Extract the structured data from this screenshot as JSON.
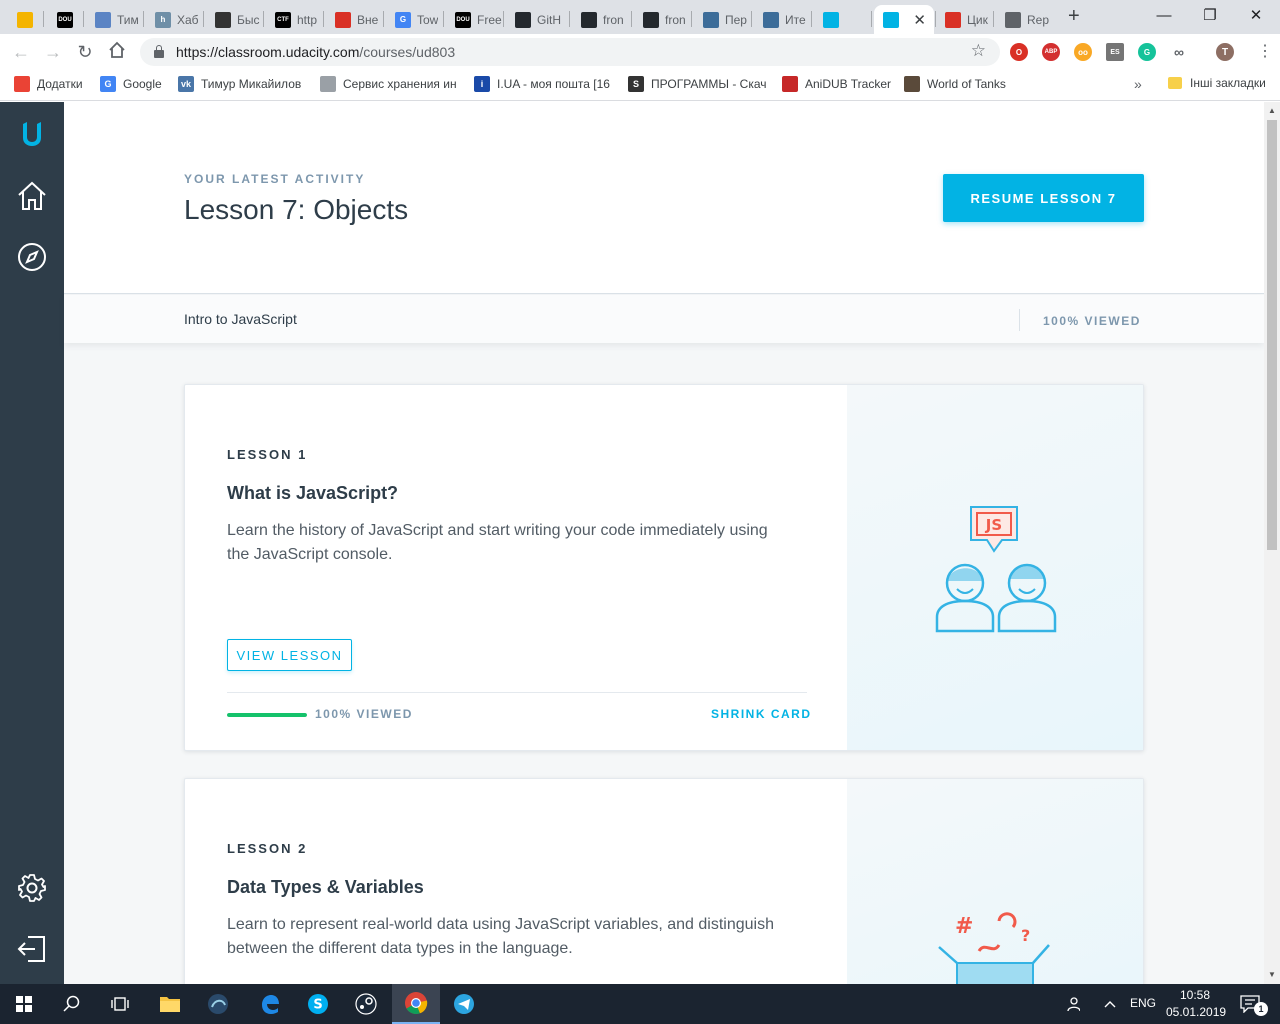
{
  "browser": {
    "tabs": [
      {
        "title": "",
        "fav": "google-slides-icon",
        "color": "#f4b400"
      },
      {
        "title": "",
        "fav": "dou-icon",
        "color": "#000000",
        "text": "DOU"
      },
      {
        "title": "Тим",
        "fav": "tilda-icon",
        "color": "#5b84c4"
      },
      {
        "title": "Хаб",
        "fav": "habr-icon",
        "color": "#6f8fa7",
        "text": "h"
      },
      {
        "title": "Быс",
        "fav": "doc-icon",
        "color": "#333333"
      },
      {
        "title": "http",
        "fav": "ctf-icon",
        "color": "#000000",
        "text": "CTF"
      },
      {
        "title": "Вне",
        "fav": "figure-icon",
        "color": "#d93025"
      },
      {
        "title": "Tow",
        "fav": "google-icon",
        "color": "#4285f4",
        "text": "G"
      },
      {
        "title": "Free",
        "fav": "dou-icon",
        "color": "#000000",
        "text": "DOU"
      },
      {
        "title": "GitH",
        "fav": "github-icon",
        "color": "#24292e"
      },
      {
        "title": "fron",
        "fav": "github-icon",
        "color": "#24292e"
      },
      {
        "title": "fron",
        "fav": "github-icon",
        "color": "#24292e"
      },
      {
        "title": "Пер",
        "fav": "hexlet-icon",
        "color": "#3d6d99"
      },
      {
        "title": "Ите",
        "fav": "hexlet-icon",
        "color": "#3d6d99"
      },
      {
        "title": "",
        "fav": "udacity-icon",
        "color": "#02b3e4"
      },
      {
        "title": "",
        "fav": "udacity-icon",
        "color": "#02b3e4",
        "active": true
      },
      {
        "title": "Цик",
        "fav": "figure-icon",
        "color": "#d93025"
      },
      {
        "title": "Rep",
        "fav": "replit-icon",
        "color": "#5f6368"
      }
    ],
    "url_domain": "https://classroom.udacity.com",
    "url_path": "/courses/ud803",
    "bookmarks": [
      {
        "label": "Додатки",
        "fav": "apps-icon",
        "color": "#ea4335"
      },
      {
        "label": "Google",
        "fav": "google-icon",
        "color": "#4285f4",
        "text": "G"
      },
      {
        "label": "Тимур Микайилов",
        "fav": "vk-icon",
        "color": "#4a76a8",
        "text": "vk"
      },
      {
        "label": "Сервис хранения ин",
        "fav": "mail-icon",
        "color": "#9aa0a6"
      },
      {
        "label": "I.UA - моя пошта [16",
        "fav": "iua-icon",
        "color": "#1a4aa8",
        "text": "i"
      },
      {
        "label": "ПРОГРАММЫ - Скач",
        "fav": "soft-icon",
        "color": "#333333",
        "text": "S"
      },
      {
        "label": "AniDUB Tracker",
        "fav": "anidub-icon",
        "color": "#c62828"
      },
      {
        "label": "World of Tanks",
        "fav": "wot-icon",
        "color": "#5a4a3a"
      }
    ],
    "other_bookmarks": "Інші закладки"
  },
  "activity": {
    "kicker": "YOUR LATEST ACTIVITY",
    "title": "Lesson 7: Objects",
    "resume_label": "RESUME LESSON 7"
  },
  "course_bar": {
    "name": "Intro to JavaScript",
    "progress": "100% VIEWED"
  },
  "lessons": [
    {
      "kicker": "LESSON 1",
      "title": "What is JavaScript?",
      "description": "Learn the history of JavaScript and start writing your code immediately using the JavaScript console.",
      "view_label": "VIEW LESSON",
      "progress_text": "100% VIEWED",
      "progress_fraction": 1.0,
      "shrink_label": "SHRINK CARD"
    },
    {
      "kicker": "LESSON 2",
      "title": "Data Types & Variables",
      "description": "Learn to represent real-world data using JavaScript variables, and distinguish between the different data types in the language."
    }
  ],
  "taskbar": {
    "lang": "ENG",
    "time": "10:58",
    "date": "05.01.2019",
    "notif_count": "1"
  },
  "colors": {
    "accent": "#02b3e4",
    "sidebar": "#2e3d49",
    "progress": "#15c26b",
    "js_badge": "#f15a4a"
  }
}
